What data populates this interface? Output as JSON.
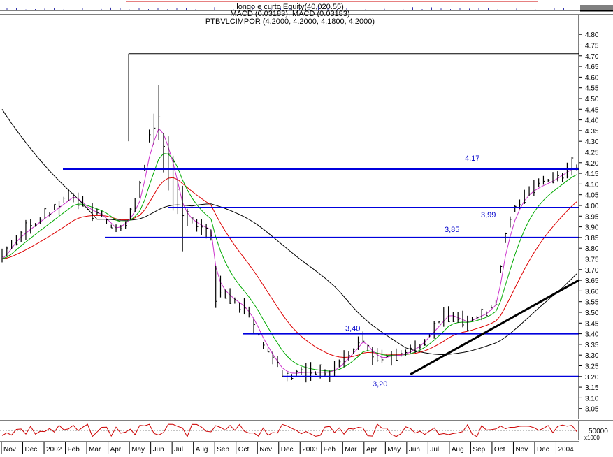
{
  "header": {
    "line1": "longo e curto Equity(40,020.55)",
    "line2": "MACD (0.03183), MACD (0.03183)",
    "line3": "PTBVLCIMPOR (4.2000, 4.2000, 4.1800, 4.2000)"
  },
  "colors": {
    "price_bars": "#000000",
    "ma_short": "#cc33cc",
    "ma_green": "#00aa00",
    "ma_red": "#dd0000",
    "ma_long": "#000000",
    "levels": "#0000dd",
    "trendline": "#000000",
    "oscillator": "#cc0000",
    "label_text": "#0000cc"
  },
  "chart_data": {
    "type": "line",
    "ylim": [
      3.0,
      4.83
    ],
    "yticks": [
      "4.80",
      "4.75",
      "4.70",
      "4.65",
      "4.60",
      "4.55",
      "4.50",
      "4.45",
      "4.40",
      "4.35",
      "4.30",
      "4.25",
      "4.20",
      "4.15",
      "4.10",
      "4.05",
      "4.00",
      "3.95",
      "3.90",
      "3.85",
      "3.80",
      "3.75",
      "3.70",
      "3.65",
      "3.60",
      "3.55",
      "3.50",
      "3.45",
      "3.40",
      "3.35",
      "3.30",
      "3.25",
      "3.20",
      "3.15",
      "3.10",
      "3.05"
    ],
    "xlabels": [
      "Nov",
      "Dec",
      "2002",
      "Feb",
      "Mar",
      "Apr",
      "May",
      "Jun",
      "Jul",
      "Aug",
      "Sep",
      "Oct",
      "Nov",
      "Dec",
      "2003",
      "Feb",
      "Mar",
      "Apr",
      "May",
      "Jun",
      "Jul",
      "Aug",
      "Sep",
      "Oct",
      "Nov",
      "Dec",
      "2004"
    ],
    "price_keypoints": [
      [
        0,
        3.75
      ],
      [
        3,
        3.85
      ],
      [
        6,
        3.9
      ],
      [
        9,
        3.95
      ],
      [
        12,
        4.0
      ],
      [
        15,
        4.05
      ],
      [
        18,
        3.98
      ],
      [
        21,
        3.95
      ],
      [
        24,
        3.88
      ],
      [
        27,
        3.95
      ],
      [
        29,
        4.05
      ],
      [
        31,
        4.3
      ],
      [
        33,
        4.4
      ],
      [
        36,
        4.15
      ],
      [
        38,
        3.95
      ],
      [
        40,
        3.92
      ],
      [
        42,
        3.9
      ],
      [
        44,
        3.88
      ],
      [
        45,
        3.6
      ],
      [
        47,
        3.58
      ],
      [
        49,
        3.55
      ],
      [
        51,
        3.52
      ],
      [
        53,
        3.45
      ],
      [
        55,
        3.35
      ],
      [
        57,
        3.28
      ],
      [
        59,
        3.22
      ],
      [
        61,
        3.21
      ],
      [
        63,
        3.22
      ],
      [
        65,
        3.22
      ],
      [
        67,
        3.22
      ],
      [
        69,
        3.22
      ],
      [
        71,
        3.25
      ],
      [
        73,
        3.3
      ],
      [
        75,
        3.35
      ],
      [
        76,
        3.38
      ],
      [
        78,
        3.3
      ],
      [
        80,
        3.28
      ],
      [
        82,
        3.3
      ],
      [
        84,
        3.3
      ],
      [
        86,
        3.32
      ],
      [
        88,
        3.35
      ],
      [
        90,
        3.4
      ],
      [
        92,
        3.45
      ],
      [
        94,
        3.5
      ],
      [
        96,
        3.47
      ],
      [
        98,
        3.45
      ],
      [
        100,
        3.48
      ],
      [
        102,
        3.5
      ],
      [
        104,
        3.55
      ],
      [
        106,
        3.85
      ],
      [
        108,
        3.98
      ],
      [
        110,
        4.05
      ],
      [
        112,
        4.08
      ],
      [
        114,
        4.1
      ],
      [
        116,
        4.12
      ],
      [
        118,
        4.15
      ],
      [
        120,
        4.18
      ]
    ],
    "levels": [
      {
        "value": 4.17,
        "label": "4,17"
      },
      {
        "value": 3.99,
        "label": "3,99"
      },
      {
        "value": 3.85,
        "label": "3,85"
      },
      {
        "value": 3.4,
        "label": "3,40"
      },
      {
        "value": 3.2,
        "label": "3,20"
      }
    ],
    "peak_line": 4.71,
    "trendline": {
      "x0": 86,
      "y0": 3.21,
      "x1": 121,
      "y1": 3.65
    },
    "oscillator": {
      "level_label": "50000",
      "unit_label": "x1000"
    },
    "x_count": 122
  }
}
